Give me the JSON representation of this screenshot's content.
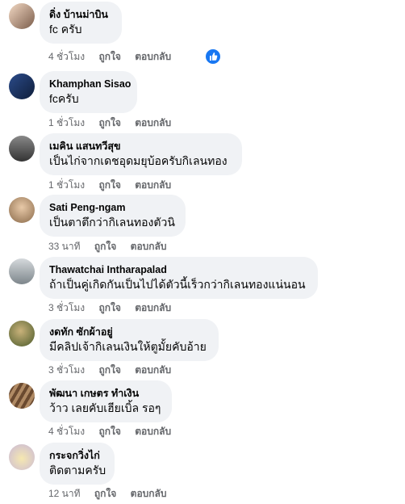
{
  "comments": [
    {
      "author": "ดิ่ง บ้านม่าบิน",
      "text": "fc ครับ",
      "time": "4 ชั่วโมง",
      "like": "ถูกใจ",
      "reply": "ตอบกลับ",
      "avatar_color": "#7a5c4a",
      "has_reaction": true
    },
    {
      "author": "Khamphan Sisao",
      "text": "fcครับ",
      "time": "1 ชั่วโมง",
      "like": "ถูกใจ",
      "reply": "ตอบกลับ",
      "avatar_color": "#2b4b8a",
      "has_reaction": false
    },
    {
      "author": "เมคิน แสนทวีสุข",
      "text": "เป็นไก่จากเดชอุดมยุบ้อครับกิเลนทอง",
      "time": "1 ชั่วโมง",
      "like": "ถูกใจ",
      "reply": "ตอบกลับ",
      "avatar_color": "#555555",
      "has_reaction": false
    },
    {
      "author": "Sati Peng-ngam",
      "text": "เป็นตาตึกว่ากิเลนทองตัวนิ",
      "time": "33 นาที",
      "like": "ถูกใจ",
      "reply": "ตอบกลับ",
      "avatar_color": "#b48a6a",
      "has_reaction": false
    },
    {
      "author": "Thawatchai Intharapalad",
      "text": "ถ้าเป็นคู่เกิดกันเป็นไปได้ตัวนี้เร็วกว่ากิเลนทองแน่นอน",
      "time": "3 ชั่วโมง",
      "like": "ถูกใจ",
      "reply": "ตอบกลับ",
      "avatar_color": "#9aa3a8",
      "has_reaction": false
    },
    {
      "author": "งดทัก ซักผ้าอยู่",
      "text": "มีคลิปเจ้ากิเลนเงินให้ตูมั้ยคับอ้าย",
      "time": "3 ชั่วโมง",
      "like": "ถูกใจ",
      "reply": "ตอบกลับ",
      "avatar_color": "#6b7a3a",
      "has_reaction": false
    },
    {
      "author": "พัฒนา เกษตร ทำเงิน",
      "text": "ว้าว เลยคับเฮียเบิ้ล รอๆ",
      "time": "4 ชั่วโมง",
      "like": "ถูกใจ",
      "reply": "ตอบกลับ",
      "avatar_color": "#8a6a4a",
      "has_reaction": false
    },
    {
      "author": "กระจกวิ่งไก่",
      "text": "ติดตามครับ",
      "time": "12 นาที",
      "like": "ถูกใจ",
      "reply": "ตอบกลับ",
      "avatar_color": "#c9b8d8",
      "has_reaction": false
    }
  ]
}
